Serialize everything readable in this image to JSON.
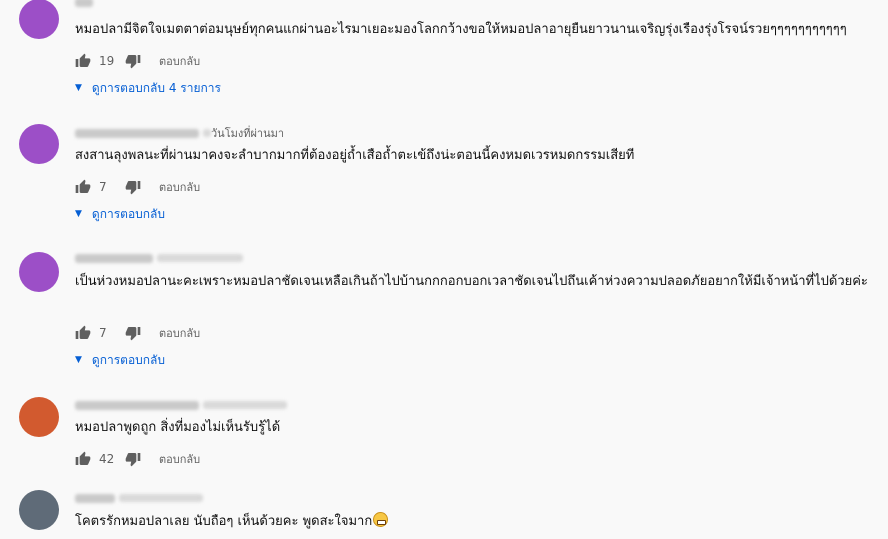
{
  "colors": {
    "background": "#f9f9f9",
    "link_blue": "#065fd4",
    "muted": "#606060",
    "avatar_purple": "#9c4fc7",
    "avatar_orange": "#d25a2f",
    "avatar_gray": "#5f6b78"
  },
  "icons": {
    "like": "thumb-up-icon",
    "dislike": "thumb-down-icon",
    "expand": "chevron-down-icon",
    "emoji": "grinning-face-emoji"
  },
  "comments": [
    {
      "time": "",
      "text": "หมอปลามีจิตใจเมตตาต่อมนุษย์ทุกคนแกผ่านอะไรมาเยอะมองโลกกว้างขอให้หมอปลาอายุยืนยาวนานเจริญรุ่งเรืองรุ่งโรจน์รวยๆๆๆๆๆๆๆๆๆๆๆ",
      "likes": "19",
      "reply": "ตอบกลับ",
      "view_replies": "ดูการตอบกลับ 4 รายการ"
    },
    {
      "time": "วันโมงที่ผ่านมา",
      "text": "สงสานลุงพลนะที่ผ่านมาคงจะลำบากมากที่ต้องอยู่ถ้ำเสือถ้ำตะเข้ถึงน่ะตอนนี้คงหมดเวรหมดกรรมเสียที",
      "likes": "7",
      "reply": "ตอบกลับ",
      "view_replies": "ดูการตอบกลับ"
    },
    {
      "time": "",
      "text": "เป็นห่วงหมอปลานะคะเพราะหมอปลาชัดเจนเหลือเกินถ้าไปบ้านกกกอกบอกเวลาชัดเจนไปถึนเค้าห่วงความปลอดภัยอยากให้มีเจ้าหน้าที่ไปด้วยค่ะ",
      "likes": "7",
      "reply": "ตอบกลับ",
      "view_replies": "ดูการตอบกลับ"
    },
    {
      "time": "",
      "text": "หมอปลาพูดถูก สิ่งที่มองไม่เห็นรับรู้ได้",
      "likes": "42",
      "reply": "ตอบกลับ"
    },
    {
      "time": "",
      "text": "โคตรรักหมอปลาเลย นับถือๆ เห็นด้วยคะ พูดสะใจมาก"
    }
  ]
}
